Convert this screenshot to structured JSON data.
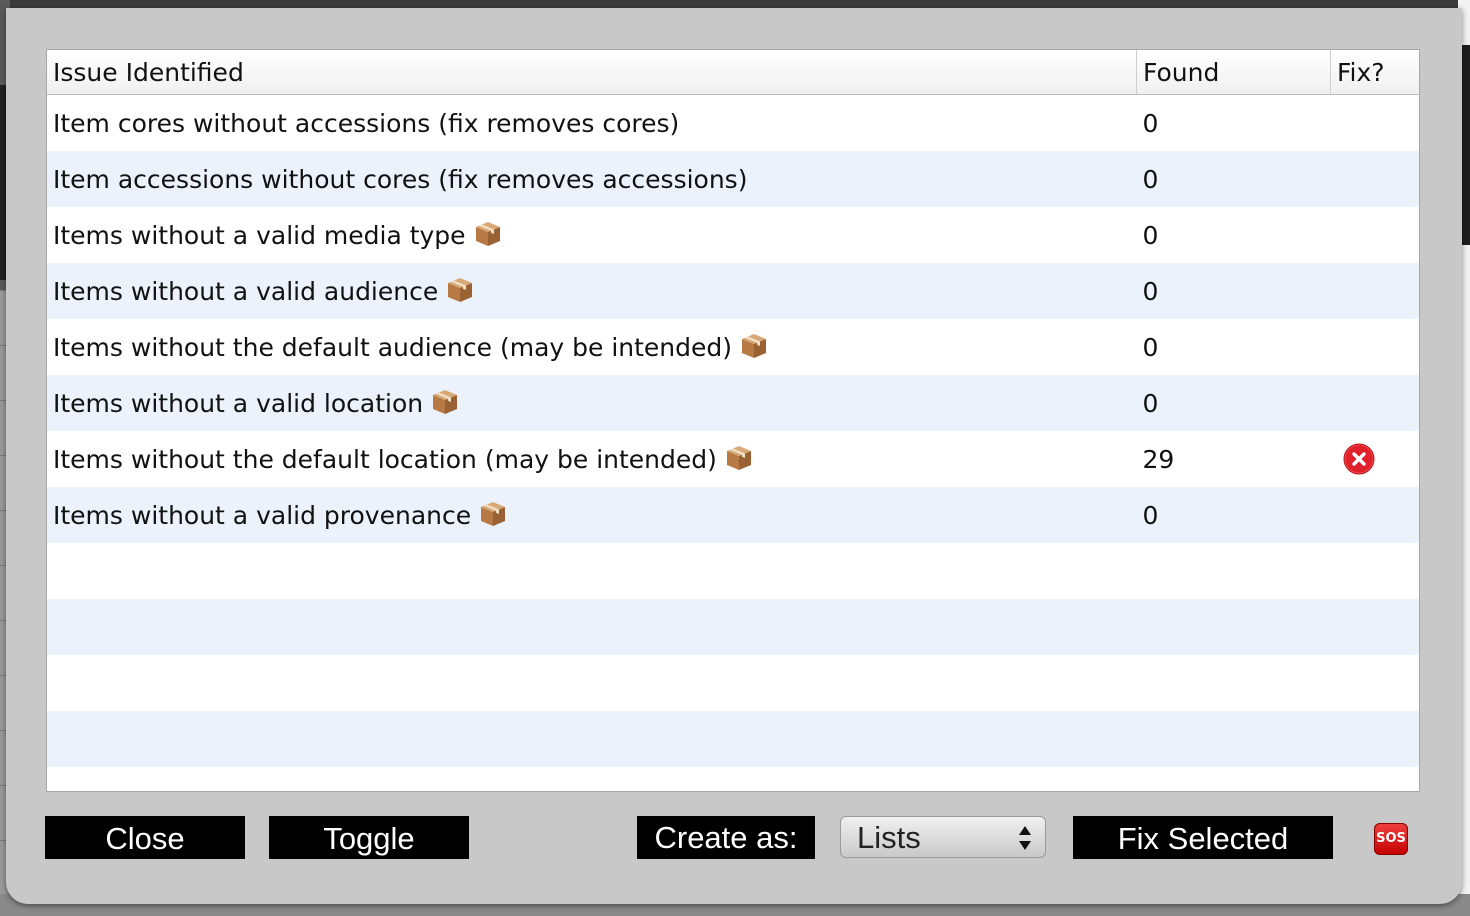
{
  "table": {
    "headers": {
      "issue": "Issue Identified",
      "found": "Found",
      "fix": "Fix?"
    },
    "rows": [
      {
        "issue": "Item cores without accessions (fix removes cores)",
        "found": "0",
        "box_icon": false,
        "fix_icon": false
      },
      {
        "issue": "Item accessions without cores (fix removes accessions)",
        "found": "0",
        "box_icon": false,
        "fix_icon": false
      },
      {
        "issue": "Items without a valid media type",
        "found": "0",
        "box_icon": true,
        "fix_icon": false
      },
      {
        "issue": "Items without a valid audience",
        "found": "0",
        "box_icon": true,
        "fix_icon": false
      },
      {
        "issue": "Items without the default audience (may be intended)",
        "found": "0",
        "box_icon": true,
        "fix_icon": false
      },
      {
        "issue": "Items without a valid location",
        "found": "0",
        "box_icon": true,
        "fix_icon": false
      },
      {
        "issue": "Items without the default location (may be intended)",
        "found": "29",
        "box_icon": true,
        "fix_icon": true
      },
      {
        "issue": "Items without a valid provenance",
        "found": "0",
        "box_icon": true,
        "fix_icon": false
      },
      {
        "issue": "",
        "found": ""
      },
      {
        "issue": "",
        "found": ""
      },
      {
        "issue": "",
        "found": ""
      },
      {
        "issue": "",
        "found": ""
      },
      {
        "issue": "",
        "found": ""
      }
    ]
  },
  "icons": {
    "box": "package-box-icon",
    "fix": "red-x-circle-icon",
    "sos": "sos-help-icon"
  },
  "buttons": {
    "close": "Close",
    "toggle": "Toggle",
    "create_as_label": "Create as:",
    "create_as_value": "Lists",
    "fix_selected": "Fix Selected",
    "sos": "SOS"
  },
  "colors": {
    "row_alt": "#ebf2fc",
    "button_bg": "#000000",
    "fix_icon": "#e0202a"
  }
}
